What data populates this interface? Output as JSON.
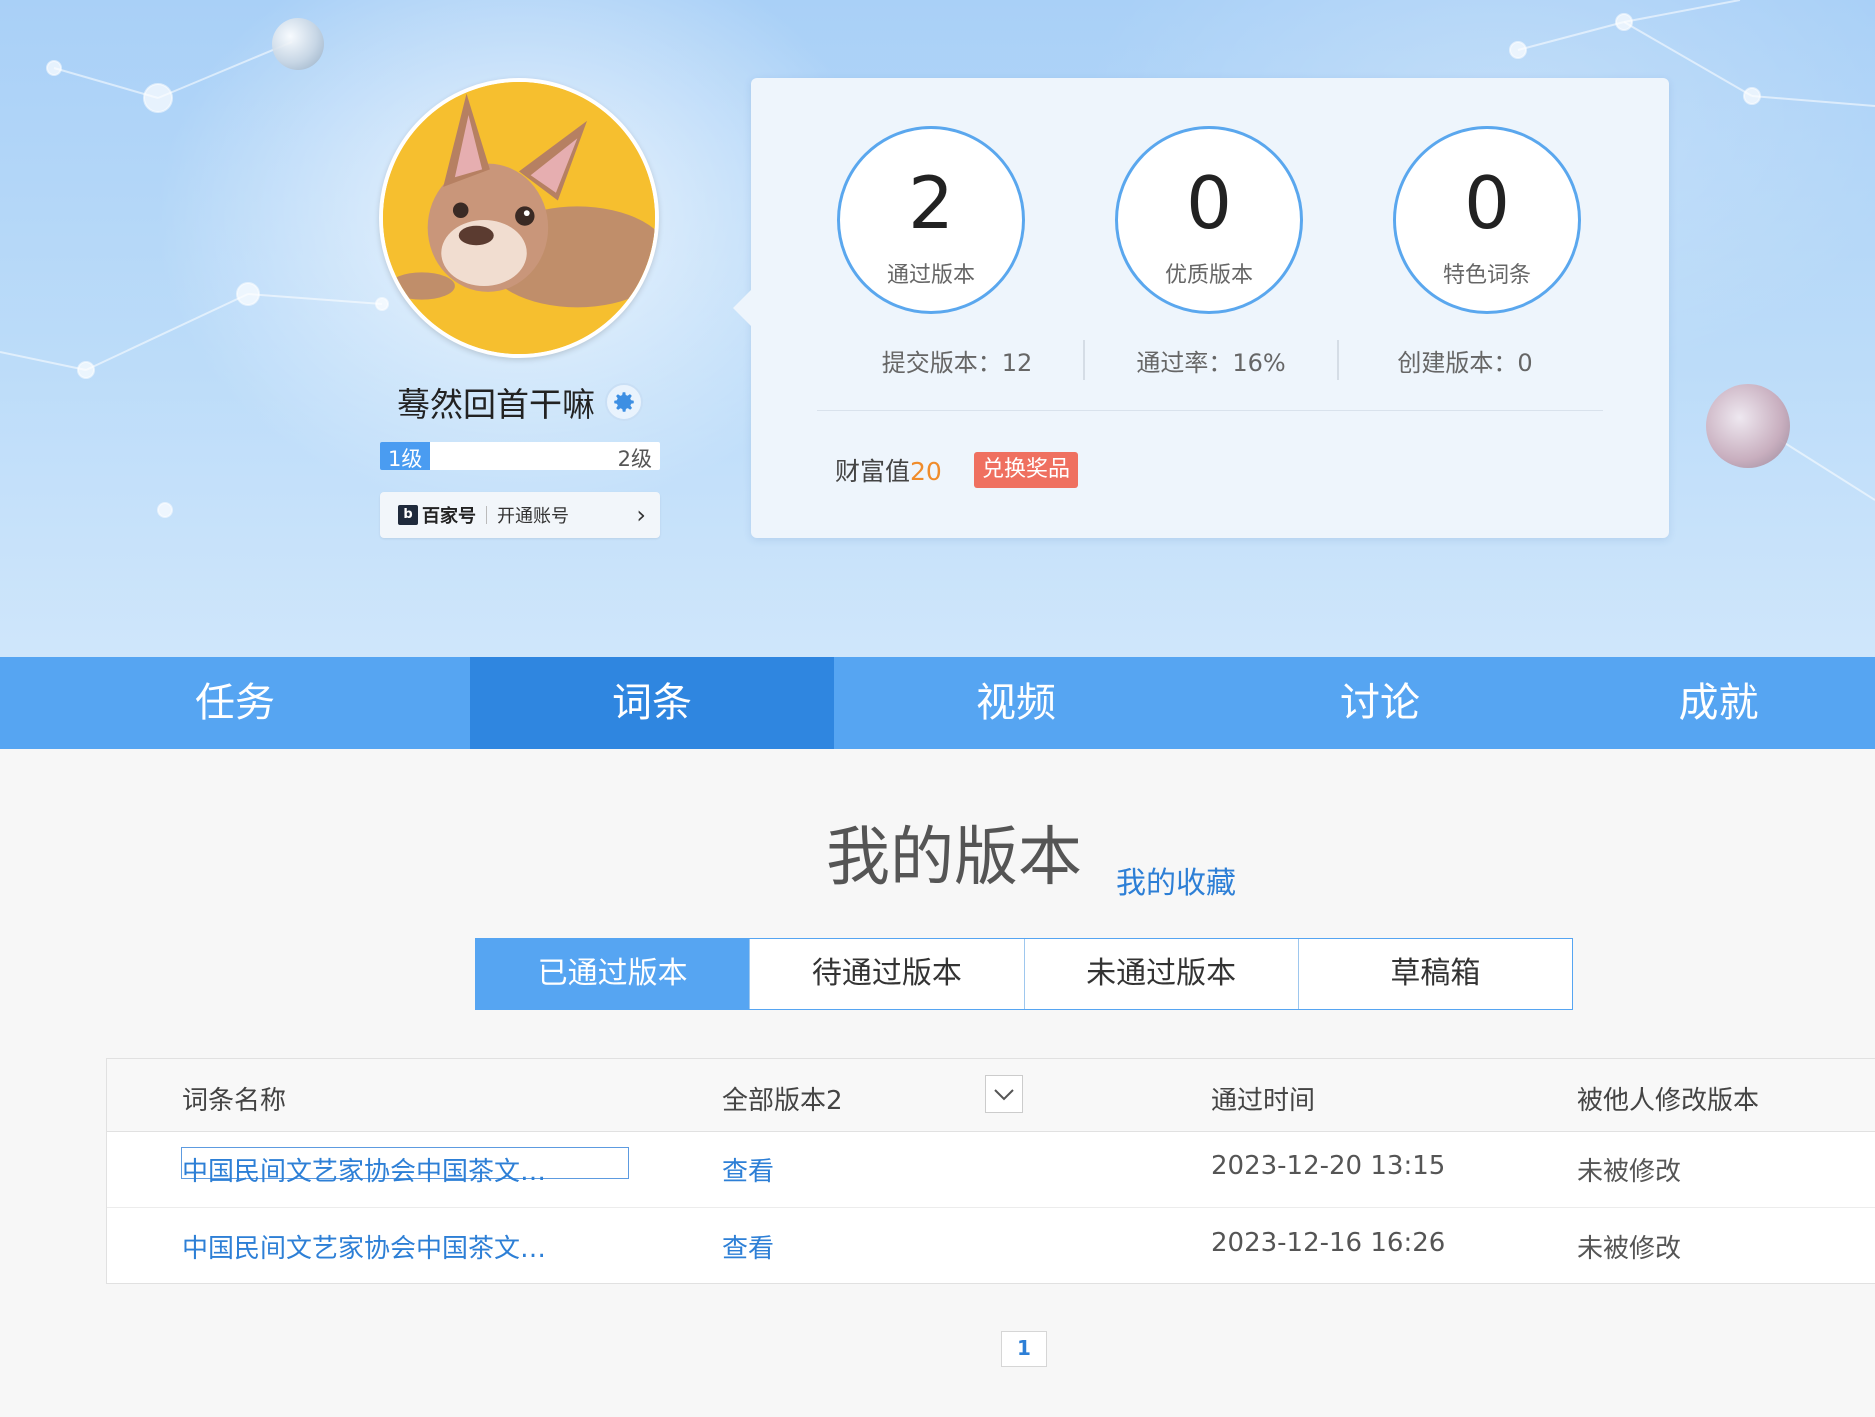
{
  "profile": {
    "username": "蓦然回首干嘛",
    "level_current": "1级",
    "level_next": "2级",
    "level_progress": 0.18,
    "baijia_logo": "百家号",
    "baijia_action": "开通账号"
  },
  "stats": {
    "circles": [
      {
        "value": "2",
        "label": "通过版本"
      },
      {
        "value": "0",
        "label": "优质版本"
      },
      {
        "value": "0",
        "label": "特色词条"
      }
    ],
    "submitted": "提交版本：12",
    "pass_rate": "通过率：16%",
    "created": "创建版本：0",
    "wealth_label": "财富值",
    "wealth_value": "20",
    "exchange_button": "兑换奖品"
  },
  "nav": {
    "items": [
      "任务",
      "词条",
      "视频",
      "讨论",
      "成就"
    ],
    "active": "词条"
  },
  "section": {
    "title": "我的版本",
    "favorites_link": "我的收藏"
  },
  "tabs": {
    "items": [
      "已通过版本",
      "待通过版本",
      "未通过版本",
      "草稿箱"
    ],
    "active": "已通过版本"
  },
  "table": {
    "headers": [
      "词条名称",
      "全部版本2",
      "通过时间",
      "被他人修改版本"
    ],
    "rows": [
      {
        "name": "中国民间文艺家协会中国茶文…",
        "action": "查看",
        "time": "2023-12-20 13:15",
        "status": "未被修改"
      },
      {
        "name": "中国民间文艺家协会中国茶文…",
        "action": "查看",
        "time": "2023-12-16 16:26",
        "status": "未被修改"
      }
    ]
  },
  "pagination": {
    "current_page": "1"
  },
  "colors": {
    "primary": "#56a5f2",
    "nav_active": "#2f86e0",
    "link": "#2d7fd6",
    "wealth": "#f08c2b",
    "exchange": "#ef7060"
  },
  "icons": [
    "gear-icon",
    "baijia-logo-icon",
    "chevron-right-icon",
    "chevron-down-icon"
  ]
}
